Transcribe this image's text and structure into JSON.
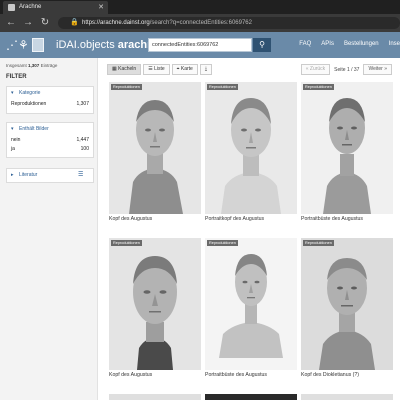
{
  "browser": {
    "tab_title": "Arachne",
    "tab_close": "✕",
    "url_host": "https://arachne.dainst.org",
    "url_path": "/search?q=connectedEntities:6069762"
  },
  "header": {
    "brand_prefix": "iDAI.objects",
    "brand_name": "arachne",
    "search_value": "connectedEntities:6069762",
    "nav": [
      "FAQ",
      "APIs",
      "Bestellungen",
      "Inse"
    ]
  },
  "sidebar": {
    "total_label": "Insgesamt",
    "total_count": "1,307",
    "total_suffix": "Einträge",
    "filter_title": "FILTER",
    "facets": [
      {
        "title": "Kategorie",
        "rows": [
          {
            "label": "Reproduktionen",
            "count": "1,307"
          }
        ]
      },
      {
        "title": "Enthält Bilder",
        "rows": [
          {
            "label": "nein",
            "count": "1,447"
          },
          {
            "label": "ja",
            "count": "100"
          }
        ]
      },
      {
        "title": "Literatur",
        "rows": []
      }
    ]
  },
  "toolbar": {
    "views": [
      "Kacheln",
      "Liste",
      "Karte"
    ],
    "active_view": "Kacheln",
    "back_label": "« Zurück",
    "page_info": "Seite 1 / 37",
    "next_label": "Weiter »"
  },
  "results": [
    {
      "badge": "Reproduktionen",
      "caption": "Kopf des Augustus"
    },
    {
      "badge": "Reproduktionen",
      "caption": "Portraitkopf des Augustus"
    },
    {
      "badge": "Reproduktionen",
      "caption": "Portraitbüste des Augustus"
    },
    {
      "badge": "Reproduktionen",
      "caption": "Kopf des Augustus"
    },
    {
      "badge": "Reproduktionen",
      "caption": "Portraitbüste des Augustus"
    },
    {
      "badge": "Reproduktionen",
      "caption": "Kopf des Diokletianus (?)"
    }
  ],
  "colors": {
    "header_bg": "#6a8aa8",
    "search_button": "#2f5272",
    "facet_title": "#2e6095",
    "badge_bg": "#6a6a6a"
  }
}
